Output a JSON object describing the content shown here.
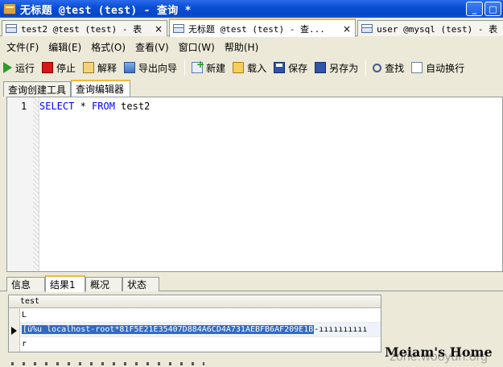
{
  "window": {
    "title": "无标题 @test (test) - 查询 *",
    "buttons": [
      "_",
      "□"
    ]
  },
  "doc_tabs": [
    {
      "label": "test2 @test (test) - 表",
      "close": "×"
    },
    {
      "label": "无标题 @test (test) - 查...",
      "close": "×"
    },
    {
      "label": "user @mysql (test) - 表",
      "close": ""
    }
  ],
  "menu": [
    "文件(F)",
    "编辑(E)",
    "格式(O)",
    "查看(V)",
    "窗口(W)",
    "帮助(H)"
  ],
  "toolbar": {
    "run": "运行",
    "stop": "停止",
    "explain": "解释",
    "export": "导出向导",
    "new": "新建",
    "load": "载入",
    "save": "保存",
    "save_as": "另存为",
    "find": "查找",
    "auto_wrap": "自动换行"
  },
  "editor_tabs": [
    "查询创建工具",
    "查询编辑器"
  ],
  "editor": {
    "line_number": "1",
    "code": {
      "kw1": "SELECT",
      "star": " * ",
      "kw2": "FROM",
      "table": " test2"
    }
  },
  "result_tabs": [
    "信息",
    "结果1",
    "概况",
    "状态"
  ],
  "grid": {
    "column": "test",
    "rows": [
      {
        "value": "L"
      },
      {
        "selected": "[ü%u    localhost-root*81F5E21E35407D884A6CD4A731AEBFB6AF209E1B",
        "rest": "-ıııııııııı"
      },
      {
        "value": "r"
      }
    ]
  },
  "watermarks": {
    "home": "Meiam's Home",
    "zone": "zone.wooyun.org"
  }
}
